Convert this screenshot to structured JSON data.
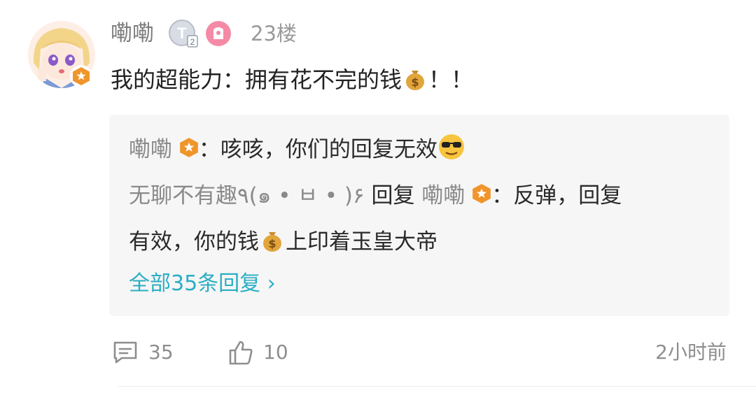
{
  "comment": {
    "username": "嘞嘞",
    "floor": "23楼",
    "content": "我的超能力：拥有花不完的钱",
    "content_suffix": "！！",
    "level_badge": "T2",
    "avatar_icon": "anime-girl-avatar",
    "verified_badge_color": "#f0952b"
  },
  "replies": [
    {
      "nick": "嘞嘞",
      "text": "：咳咳，你们的回复无效",
      "emoji": "sunglasses-emoji"
    },
    {
      "nick": "无聊不有趣٩(๑ • ㅂ • )۶",
      "reply_word": "回复",
      "target": "嘞嘞",
      "text_line1": "：反弹，回复",
      "text_line2_a": "有效，你的钱",
      "text_line2_b": "上印着玉皇大帝"
    }
  ],
  "all_replies_label": "全部35条回复 ›",
  "footer": {
    "comment_count": "35",
    "like_count": "10",
    "time": "2小时前"
  },
  "colors": {
    "link": "#2aaec4",
    "badge_orange": "#f0952b",
    "reply_bg": "#f6f6f6"
  }
}
